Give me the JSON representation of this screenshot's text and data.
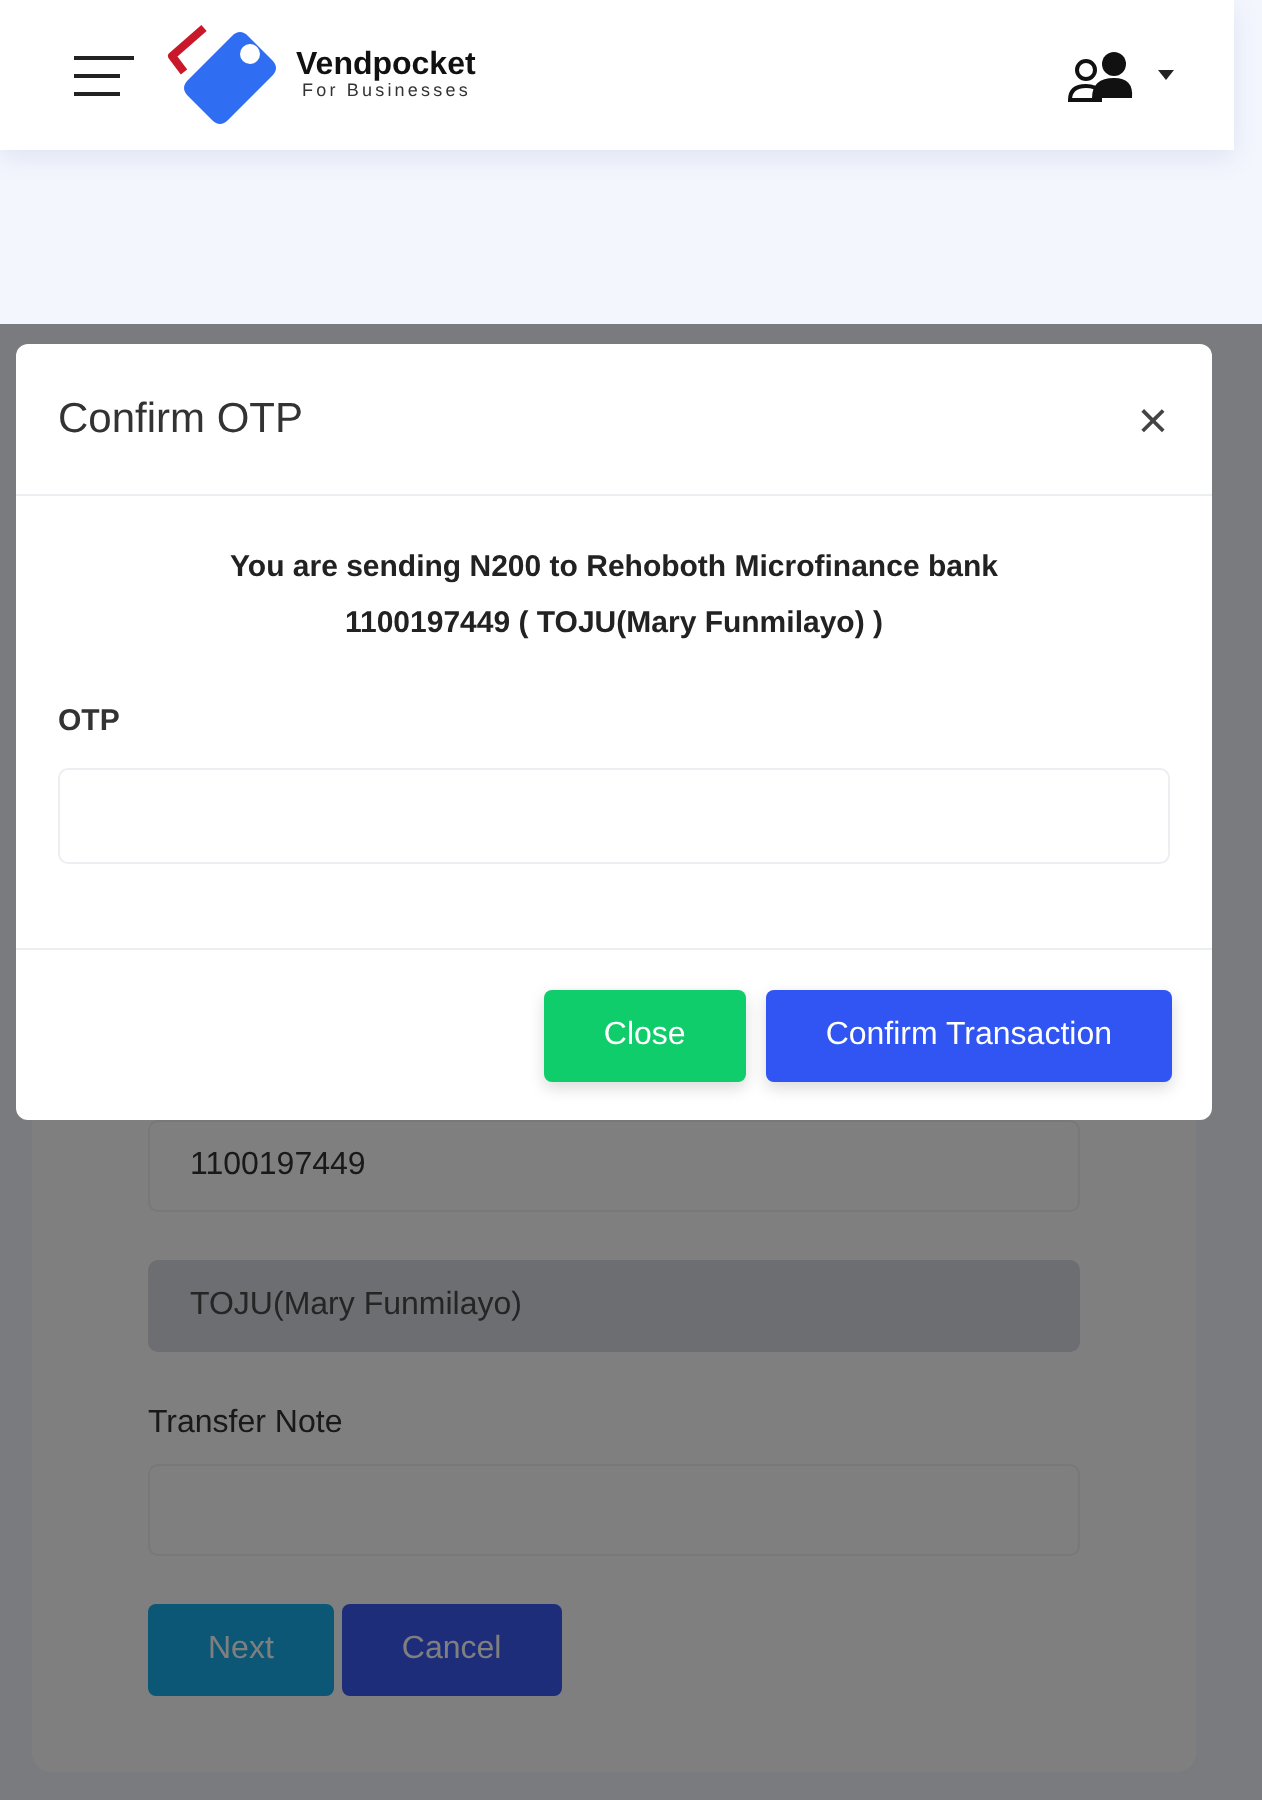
{
  "header": {
    "brand": "Vendpocket",
    "tagline": "For Businesses"
  },
  "modal": {
    "title": "Confirm OTP",
    "close": "×",
    "message": "You are sending N200 to Rehoboth Microfinance bank 1100197449 ( TOJU(Mary Funmilayo) )",
    "field": {
      "label": "OTP"
    },
    "buttons": [
      {
        "label": "Close",
        "kind": "success"
      },
      {
        "label": "Confirm Transaction",
        "kind": "primary"
      }
    ]
  },
  "form": {
    "fields": [
      {
        "value": "1100197449",
        "disabled": false
      },
      {
        "value": "TOJU(Mary Funmilayo)",
        "disabled": true
      },
      {
        "label": "Transfer Note",
        "disabled": false
      }
    ],
    "buttons": [
      {
        "label": "Next",
        "kind": "info"
      },
      {
        "label": "Cancel",
        "kind": "primary"
      }
    ]
  }
}
